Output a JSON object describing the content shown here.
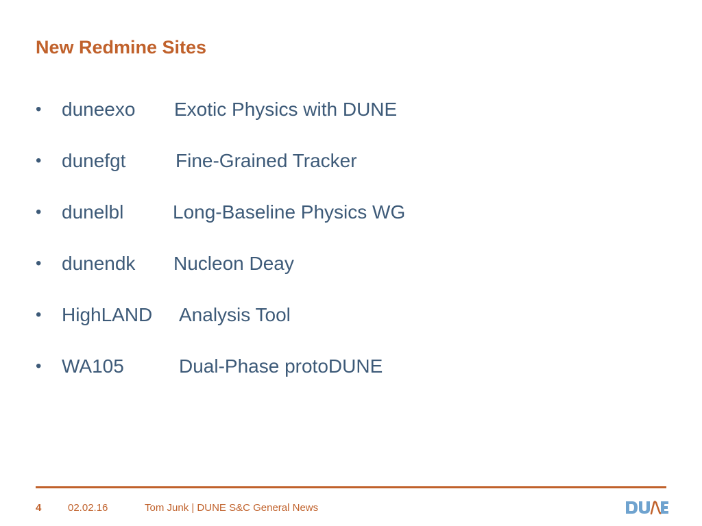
{
  "slide": {
    "title": "New Redmine Sites",
    "items": [
      {
        "term": "duneexo",
        "description": "Exotic Physics with DUNE"
      },
      {
        "term": "dunefgt",
        "description": "Fine-Grained Tracker"
      },
      {
        "term": "dunelbl",
        "description": "Long-Baseline Physics WG"
      },
      {
        "term": "dunendk",
        "description": "Nucleon Deay"
      },
      {
        "term": "HighLAND",
        "description": "Analysis Tool"
      },
      {
        "term": "WA105",
        "description": "Dual-Phase protoDUNE"
      }
    ],
    "bullet_glyph": "•"
  },
  "footer": {
    "page_number": "4",
    "date": "02.02.16",
    "author_line": "Tom Junk | DUNE S&C General News",
    "logo": "dune-logo"
  },
  "colors": {
    "accent": "#c0612b",
    "body_text": "#3d5a78",
    "logo_blue": "#6fa3cf"
  }
}
